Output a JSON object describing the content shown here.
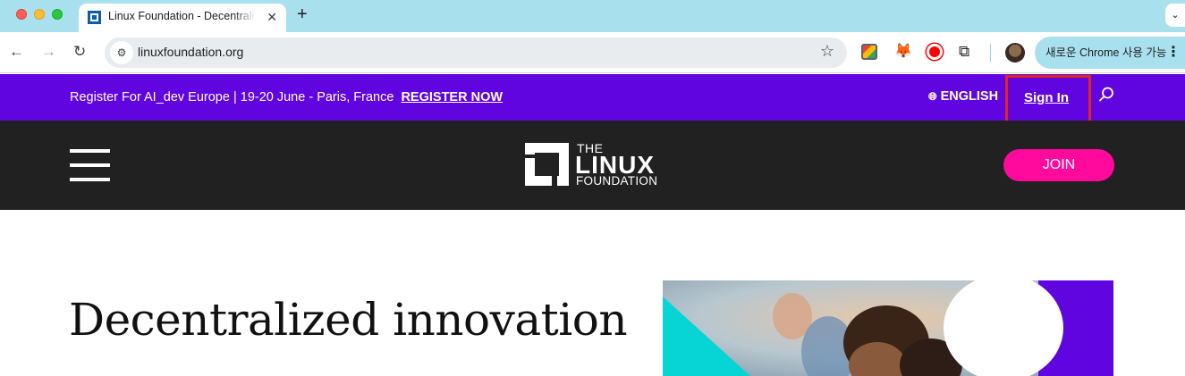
{
  "browser": {
    "tab_title": "Linux Foundation - Decentralized innovation",
    "tab_close": "✕",
    "new_tab": "+",
    "tab_menu": "⌄",
    "url": "linuxfoundation.org",
    "chrome_promo": "새로운 Chrome 사용 가능",
    "menu_dots": "⋮"
  },
  "announcement": {
    "text": "Register For AI_dev Europe | 19-20 June - Paris, France",
    "cta": "REGISTER NOW",
    "language": "ENGLISH",
    "sign_in": "Sign In"
  },
  "nav": {
    "logo": {
      "the": "THE",
      "linux": "LINUX",
      "foundation": "FOUNDATION"
    },
    "join_label": "JOIN"
  },
  "hero": {
    "heading": "Decentralized innovation"
  },
  "colors": {
    "promo_bg": "#6005e0",
    "nav_bg": "#212121",
    "join_bg": "#ff0a9c",
    "highlight": "#e1251b"
  }
}
